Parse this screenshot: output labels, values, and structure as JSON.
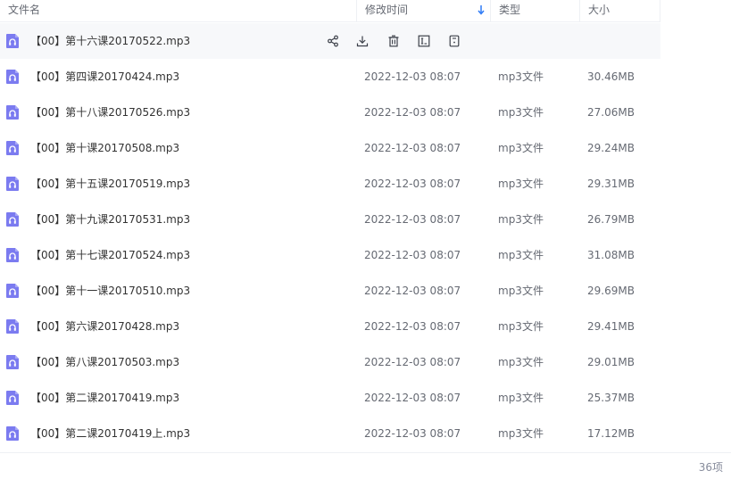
{
  "header": {
    "name": "文件名",
    "time": "修改时间",
    "type": "类型",
    "size": "大小"
  },
  "files": [
    {
      "name": "【00】第十六课20170522.mp3",
      "time": "",
      "type": "",
      "size": ""
    },
    {
      "name": "【00】第四课20170424.mp3",
      "time": "2022-12-03 08:07",
      "type": "mp3文件",
      "size": "30.46MB"
    },
    {
      "name": "【00】第十八课20170526.mp3",
      "time": "2022-12-03 08:07",
      "type": "mp3文件",
      "size": "27.06MB"
    },
    {
      "name": "【00】第十课20170508.mp3",
      "time": "2022-12-03 08:07",
      "type": "mp3文件",
      "size": "29.24MB"
    },
    {
      "name": "【00】第十五课20170519.mp3",
      "time": "2022-12-03 08:07",
      "type": "mp3文件",
      "size": "29.31MB"
    },
    {
      "name": "【00】第十九课20170531.mp3",
      "time": "2022-12-03 08:07",
      "type": "mp3文件",
      "size": "26.79MB"
    },
    {
      "name": "【00】第十七课20170524.mp3",
      "time": "2022-12-03 08:07",
      "type": "mp3文件",
      "size": "31.08MB"
    },
    {
      "name": "【00】第十一课20170510.mp3",
      "time": "2022-12-03 08:07",
      "type": "mp3文件",
      "size": "29.69MB"
    },
    {
      "name": "【00】第六课20170428.mp3",
      "time": "2022-12-03 08:07",
      "type": "mp3文件",
      "size": "29.41MB"
    },
    {
      "name": "【00】第八课20170503.mp3",
      "time": "2022-12-03 08:07",
      "type": "mp3文件",
      "size": "29.01MB"
    },
    {
      "name": "【00】第二课20170419.mp3",
      "time": "2022-12-03 08:07",
      "type": "mp3文件",
      "size": "25.37MB"
    },
    {
      "name": "【00】第二课20170419上.mp3",
      "time": "2022-12-03 08:07",
      "type": "mp3文件",
      "size": "17.12MB"
    }
  ],
  "footer": {
    "count": "36项"
  },
  "icons": {
    "file": "audio-file-icon",
    "sort": "sort-down-icon",
    "share": "share-icon",
    "download": "download-icon",
    "delete": "trash-icon",
    "rename": "rename-icon",
    "more": "more-icon"
  },
  "colors": {
    "file_icon": "#7b7bf0",
    "sort_arrow": "#2f7bf6",
    "action_icon": "#3b3f48",
    "hover_row": "#f7f8fa"
  }
}
